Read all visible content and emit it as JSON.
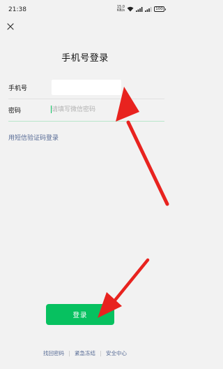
{
  "status_bar": {
    "time": "21:38",
    "net_speed_value": "15.0",
    "net_speed_unit": "KB/s",
    "battery": "100"
  },
  "page_title": "手机号登录",
  "phone_row": {
    "label": "手机号",
    "value": ""
  },
  "password_row": {
    "label": "密码",
    "placeholder": "请填写微信密码"
  },
  "sms_login_link": "用短信验证码登录",
  "login_button": "登录",
  "footer": {
    "links": [
      "找回密码",
      "紧急冻结",
      "安全中心"
    ]
  },
  "colors": {
    "accent": "#07c160",
    "link": "#576b95",
    "annotation_arrow": "#e8231f",
    "background": "#f2f2f2"
  },
  "icons": {
    "close": "close-icon",
    "signal": "signal-icon",
    "wifi": "wifi-icon",
    "battery": "battery-icon"
  }
}
